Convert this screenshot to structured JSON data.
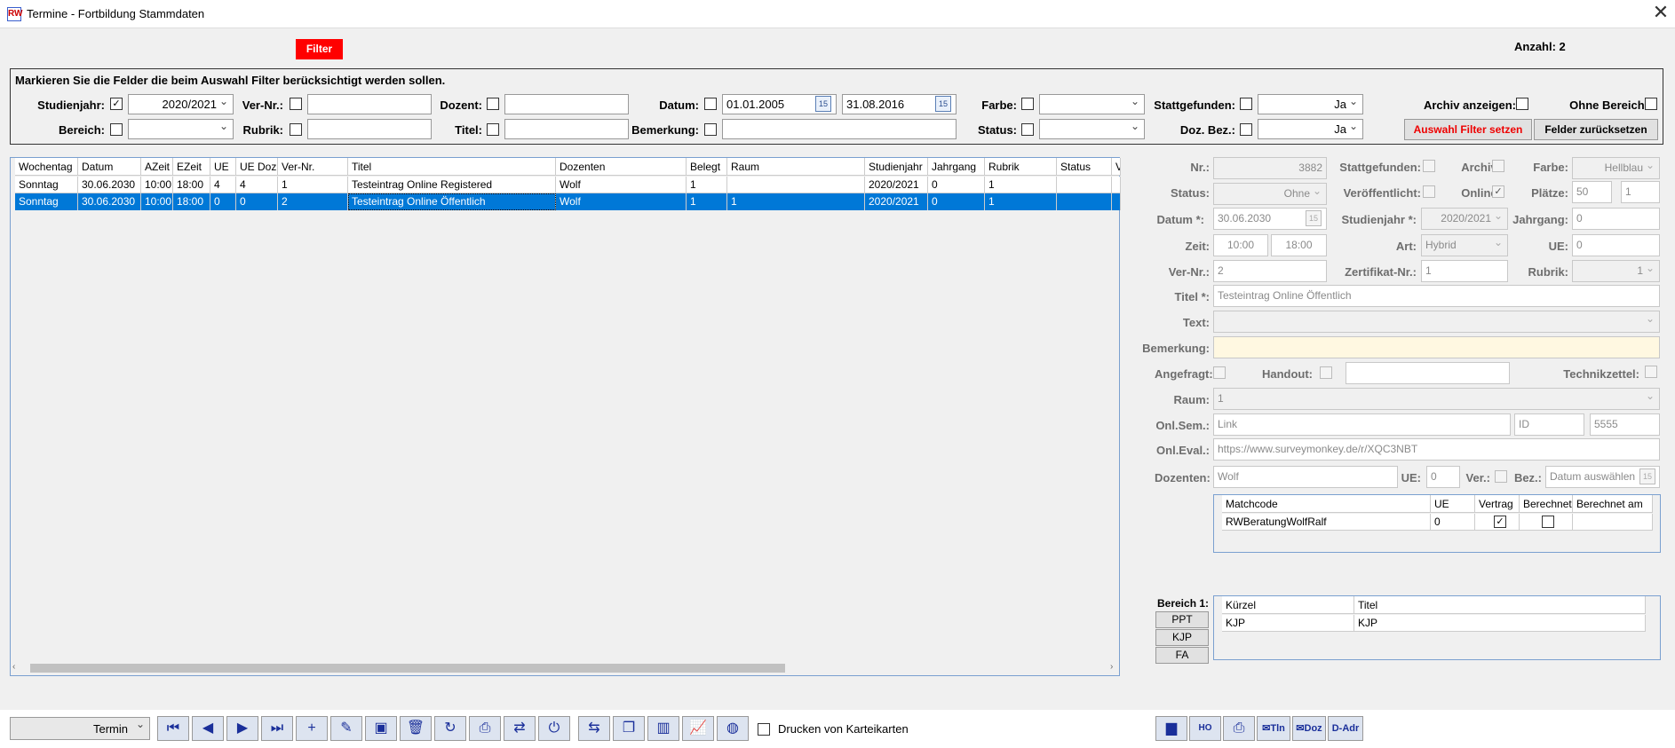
{
  "window": {
    "title": "Termine - Fortbildung Stammdaten",
    "logo": "RW",
    "close": "✕"
  },
  "header": {
    "filter_button": "Filter",
    "count": "Anzahl: 2"
  },
  "filter": {
    "instruction": "Markieren Sie die Felder die beim Auswahl Filter berücksichtigt werden sollen.",
    "studienjahr_label": "Studienjahr:",
    "studienjahr_value": "2020/2021",
    "bereich_label": "Bereich:",
    "bereich_value": "",
    "vernr_label": "Ver-Nr.:",
    "vernr_value": "",
    "rubrik_label": "Rubrik:",
    "rubrik_value": "",
    "dozent_label": "Dozent:",
    "dozent_value": "",
    "titel_label": "Titel:",
    "titel_value": "",
    "datum_label": "Datum:",
    "datum_from": "01.01.2005",
    "datum_to": "31.08.2016",
    "bemerkung_label": "Bemerkung:",
    "bemerkung_value": "",
    "farbe_label": "Farbe:",
    "farbe_value": "",
    "status_label": "Status:",
    "status_value": "",
    "stattgefunden_label": "Stattgefunden:",
    "stattgefunden_value": "Ja",
    "dozbez_label": "Doz. Bez.:",
    "dozbez_value": "Ja",
    "archiv_label": "Archiv anzeigen:",
    "ohne_bereich_label": "Ohne Bereich:",
    "apply_button": "Auswahl Filter setzen",
    "reset_button": "Felder zurücksetzen",
    "calendar_icon": "15"
  },
  "grid": {
    "columns": [
      "Wochentag",
      "Datum",
      "AZeit",
      "EZeit",
      "UE",
      "UE Doz",
      "Ver-Nr.",
      "Titel",
      "Dozenten",
      "Belegt",
      "Raum",
      "Studienjahr",
      "Jahrgang",
      "Rubrik",
      "Status",
      "V"
    ],
    "rows": [
      [
        "Sonntag",
        "30.06.2030",
        "10:00",
        "18:00",
        "4",
        "4",
        "1",
        "Testeintrag Online Registered",
        "Wolf",
        "1",
        "",
        "2020/2021",
        "0",
        "1",
        "",
        ""
      ],
      [
        "Sonntag",
        "30.06.2030",
        "10:00",
        "18:00",
        "0",
        "0",
        "2",
        "Testeintrag Online Öffentlich",
        "Wolf",
        "1",
        "1",
        "2020/2021",
        "0",
        "1",
        "",
        ""
      ]
    ],
    "selected_row": 1
  },
  "detail": {
    "nr_label": "Nr.:",
    "nr_value": "3882",
    "stattgefunden_label": "Stattgefunden:",
    "archiv_label": "Archiv:",
    "farbe_label": "Farbe:",
    "farbe_value": "Hellblau",
    "status_label": "Status:",
    "status_value": "Ohne",
    "veroeffentlicht_label": "Veröffentlicht:",
    "online_label": "Online:",
    "plaetze_label": "Plätze:",
    "plaetze_value1": "50",
    "plaetze_value2": "1",
    "datum_label": "Datum *:",
    "datum_value": "30.06.2030",
    "studienjahr_label": "Studienjahr *:",
    "studienjahr_value": "2020/2021",
    "jahrgang_label": "Jahrgang:",
    "jahrgang_value": "0",
    "zeit_label": "Zeit:",
    "zeit_from": "10:00",
    "zeit_to": "18:00",
    "art_label": "Art:",
    "art_value": "Hybrid",
    "ue_label": "UE:",
    "ue_value": "0",
    "vernr_label": "Ver-Nr.:",
    "vernr_value": "2",
    "zertifikat_label": "Zertifikat-Nr.:",
    "zertifikat_value": "1",
    "rubrik_label": "Rubrik:",
    "rubrik_value": "1",
    "titel_label": "Titel *:",
    "titel_value": "Testeintrag Online Öffentlich",
    "text_label": "Text:",
    "text_value": "",
    "bemerkung_label": "Bemerkung:",
    "bemerkung_value": "",
    "angefragt_label": "Angefragt:",
    "handout_label": "Handout:",
    "handout_value": "",
    "technikzettel_label": "Technikzettel:",
    "raum_label": "Raum:",
    "raum_value": "1",
    "onlsem_label": "Onl.Sem.:",
    "onlsem_link": "Link",
    "onlsem_id": "ID",
    "onlsem_code": "5555",
    "onleval_label": "Onl.Eval.:",
    "onleval_value": "https://www.surveymonkey.de/r/XQC3NBT",
    "dozenten_label": "Dozenten:",
    "dozenten_value": "Wolf",
    "doz_ue_label": "UE:",
    "doz_ue_value": "0",
    "ver_label": "Ver.:",
    "bez_label": "Bez.:",
    "bez_placeholder": "Datum auswählen",
    "doz_grid": {
      "columns": [
        "Matchcode",
        "UE",
        "Vertrag",
        "Berechnet",
        "Berechnet am"
      ],
      "row": [
        "RWBeratungWolfRalf",
        "0",
        "",
        "",
        ""
      ]
    },
    "bereich_label": "Bereich 1:",
    "bereich_tabs": [
      "PPT",
      "KJP",
      "FA"
    ],
    "bereich_grid": {
      "columns": [
        "Kürzel",
        "Titel"
      ],
      "row": [
        "KJP",
        "KJP"
      ]
    }
  },
  "toolbar": {
    "mode_value": "Termin",
    "print_cards_label": "Drucken von Karteikarten",
    "buttons": [
      "first-icon",
      "prev-icon",
      "next-icon",
      "last-icon",
      "add-icon",
      "edit-icon",
      "save-icon",
      "delete-icon",
      "refresh-icon",
      "print-icon",
      "swap-icon",
      "power-icon",
      "cbo-swap-icon",
      "copy-icon",
      "stats-icon",
      "chart-icon",
      "globe-icon"
    ],
    "right_buttons": {
      "tln": "Tln",
      "doz": "Doz",
      "dadr": "D-Adr"
    }
  }
}
